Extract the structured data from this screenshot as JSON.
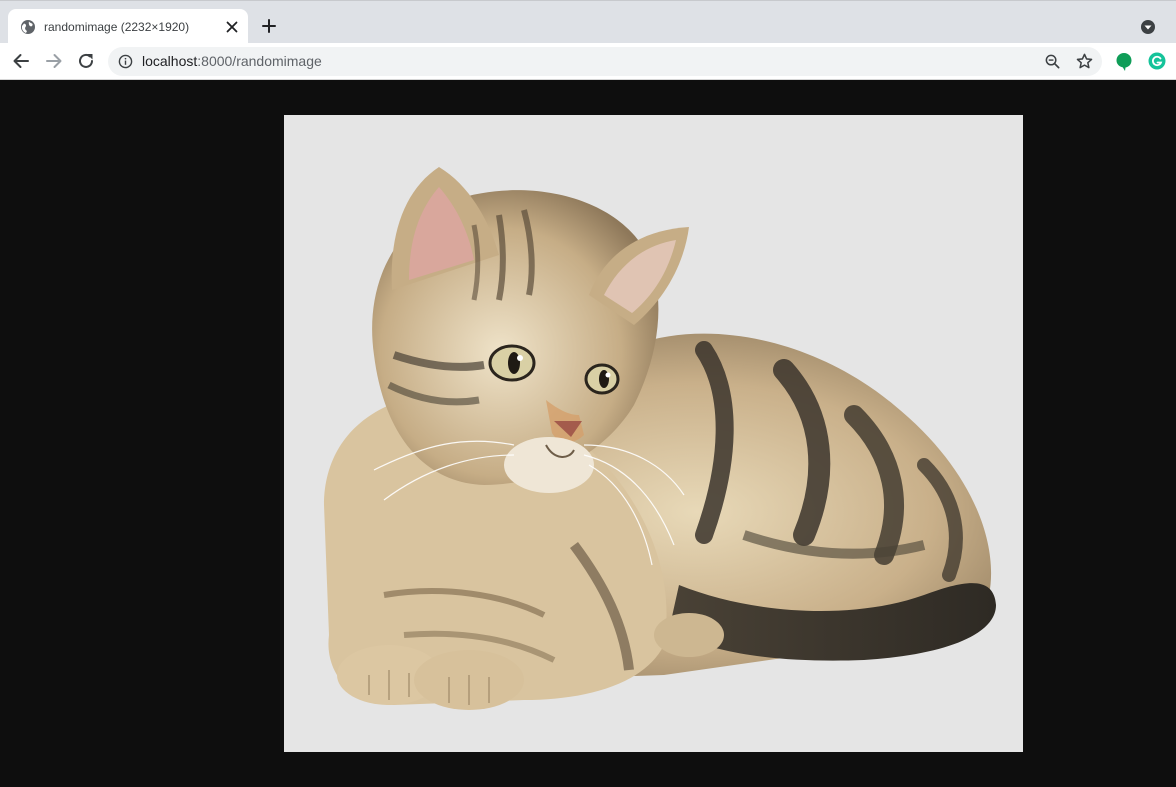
{
  "browser": {
    "tab": {
      "title": "randomimage (2232×1920)",
      "favicon": "globe-icon"
    },
    "toolbar": {
      "url_host": "localhost",
      "url_rest": ":8000/randomimage"
    }
  },
  "content": {
    "image": {
      "subject": "tabby-kitten",
      "background_color": "#e5e5e5"
    },
    "page_background": "#0e0e0e"
  }
}
